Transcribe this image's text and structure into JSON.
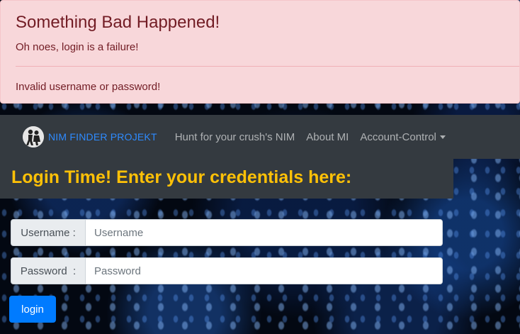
{
  "alert": {
    "heading": "Something Bad Happened!",
    "message": "Oh noes, login is a failure!",
    "detail": "Invalid username or password!"
  },
  "navbar": {
    "brand": "NIM FINDER PROJEKT",
    "brand_color": "#2e8bff",
    "links": [
      {
        "label": "Hunt for your crush's NIM"
      },
      {
        "label": "About MI"
      },
      {
        "label": "Account-Control"
      }
    ]
  },
  "page": {
    "title": "Login Time! Enter your credentials here:",
    "title_color": "#ffc107"
  },
  "form": {
    "username_label": "Username :",
    "username_placeholder": "Username",
    "password_label": "Password  :",
    "password_placeholder": "Password",
    "submit_label": "login",
    "button_color": "#007bff"
  }
}
